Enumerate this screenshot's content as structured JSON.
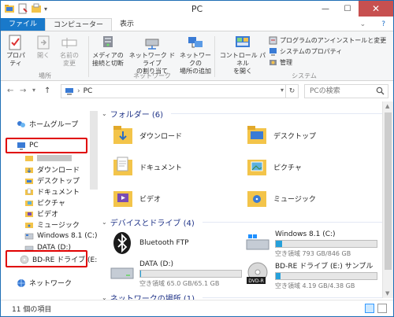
{
  "window": {
    "title": "PC",
    "close": "✕",
    "minimize": "—",
    "maximize": "☐"
  },
  "tabs": [
    {
      "label": "ファイル"
    },
    {
      "label": "コンピューター"
    },
    {
      "label": "表示"
    }
  ],
  "ribbon": {
    "location": {
      "label": "場所",
      "properties": "プロパティ",
      "open": "開く",
      "rename_1": "名前の",
      "rename_2": "変更"
    },
    "network": {
      "label": "ネットワーク",
      "media_1": "メディアの",
      "media_2": "接続と切断",
      "map_1": "ネットワーク ドライブ",
      "map_2": "の割り当て",
      "addloc_1": "ネットワークの",
      "addloc_2": "場所の追加"
    },
    "system": {
      "label": "システム",
      "control_1": "コントロール パネル",
      "control_2": "を開く",
      "uninstall": "プログラムのアンインストールと変更",
      "sysprop": "システムのプロパティ",
      "manage": "管理"
    }
  },
  "address": {
    "path": "PC",
    "separator": "›",
    "search_placeholder": "PCの検索"
  },
  "nav": {
    "homegroup": "ホームグループ",
    "pc": "PC",
    "download": "ダウンロード",
    "desktop": "デスクトップ",
    "documents": "ドキュメント",
    "pictures": "ピクチャ",
    "videos": "ビデオ",
    "music": "ミュージック",
    "win": "Windows 8.1 (C:)",
    "data": "DATA (D:)",
    "bd": "BD-RE ドライブ (E:",
    "network": "ネットワーク"
  },
  "content": {
    "folders_header": "フォルダー (6)",
    "folders": [
      "ダウンロード",
      "デスクトップ",
      "ドキュメント",
      "ピクチャ",
      "ビデオ",
      "ミュージック"
    ],
    "drives_header": "デバイスとドライブ (4)",
    "drives": {
      "bt": "Bluetooth FTP",
      "c_name": "Windows 8.1 (C:)",
      "c_free": "空き領域 793 GB/846 GB",
      "c_used": 0.06,
      "d_name": "DATA (D:)",
      "d_free": "空き領域 65.0 GB/65.1 GB",
      "d_used": 0.01,
      "e_name": "BD-RE ドライブ (E:) サンプル",
      "e_free": "空き領域 4.19 GB/4.38 GB",
      "e_used": 0.05,
      "e_badge": "DVD-R"
    },
    "netloc_header": "ネットワークの場所 (1)"
  },
  "status": {
    "count": "11 個の項目"
  }
}
